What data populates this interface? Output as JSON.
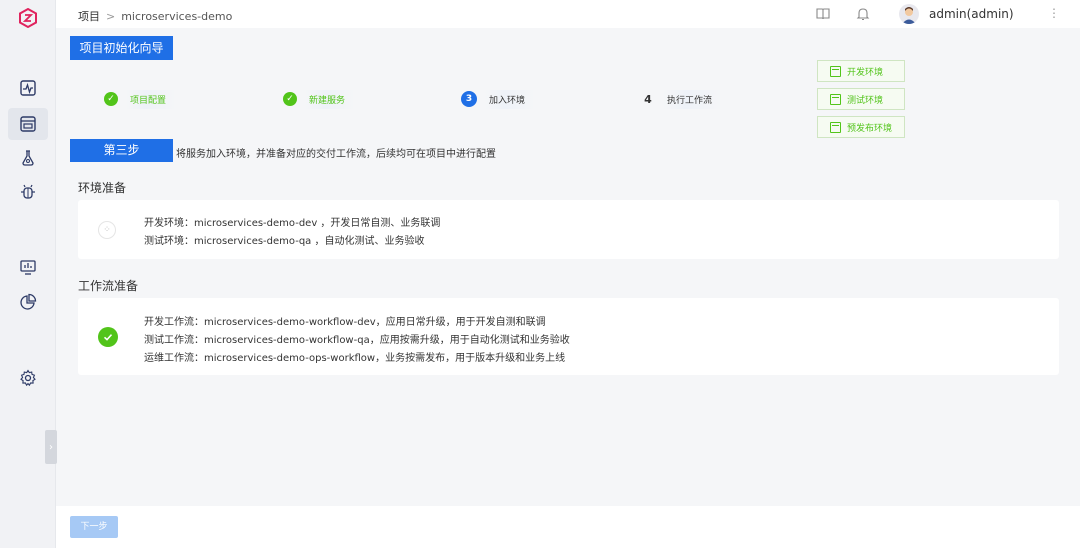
{
  "header": {
    "breadcrumb": [
      "项目",
      "microservices-demo"
    ],
    "separator": ">",
    "username": "admin(admin)"
  },
  "wizard": {
    "title": "项目初始化向导",
    "steps": [
      {
        "label": "项目配置",
        "state": "done"
      },
      {
        "label": "新建服务",
        "state": "done"
      },
      {
        "label": "加入环境",
        "state": "current",
        "num": "3"
      },
      {
        "label": "执行工作流",
        "state": "todo",
        "num": "4"
      }
    ],
    "env_buttons": [
      "开发环境",
      "测试环境",
      "预发布环境"
    ],
    "step_tag": "第三步",
    "step_desc": "将服务加入环境，并准备对应的交付工作流，后续均可在项目中进行配置"
  },
  "env_section": {
    "title": "环境准备",
    "lines": [
      "开发环境：microservices-demo-dev ，开发日常自测、业务联调",
      "测试环境：microservices-demo-qa ，自动化测试、业务验收"
    ]
  },
  "workflow_section": {
    "title": "工作流准备",
    "lines": [
      "开发工作流：microservices-demo-workflow-dev，应用日常升级，用于开发自测和联调",
      "测试工作流：microservices-demo-workflow-qa，应用按需升级，用于自动化测试和业务验收",
      "运维工作流：microservices-demo-ops-workflow，业务按需发布，用于版本升级和业务上线"
    ]
  },
  "footer": {
    "next_label": "下一步"
  },
  "colors": {
    "primary": "#1f6fe6",
    "success": "#52c41a",
    "logo": "#e0245e"
  },
  "icons": {
    "sidebar": [
      "pulse-icon",
      "project-icon",
      "flask-icon",
      "bug-icon",
      "dashboard-icon",
      "pie-chart-icon",
      "gear-icon"
    ],
    "header": [
      "book-icon",
      "bell-icon",
      "more-icon"
    ]
  }
}
